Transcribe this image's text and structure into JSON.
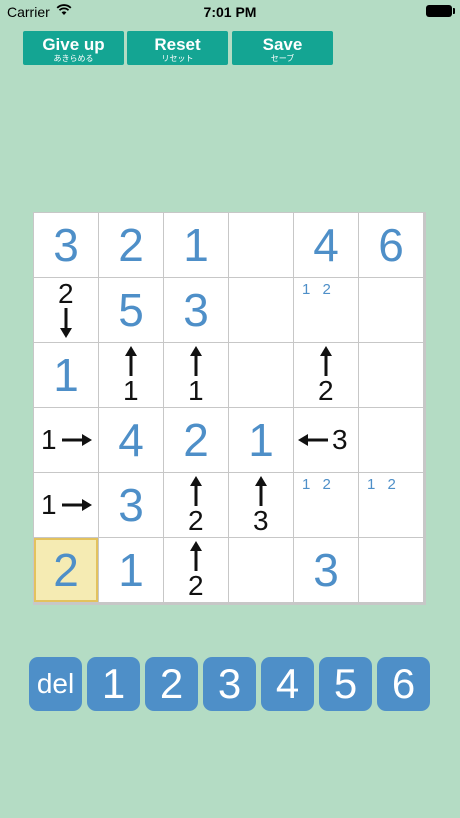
{
  "status_bar": {
    "carrier": "Carrier",
    "time": "7:01 PM"
  },
  "toolbar": {
    "give_up": {
      "label": "Give up",
      "sub": "あきらめる"
    },
    "reset": {
      "label": "Reset",
      "sub": "リセット"
    },
    "save": {
      "label": "Save",
      "sub": "セーブ"
    }
  },
  "board": {
    "size": 6,
    "selected": "r5c0",
    "cells": {
      "r0c0": {
        "value": "3"
      },
      "r0c1": {
        "value": "2"
      },
      "r0c2": {
        "value": "1"
      },
      "r0c4": {
        "value": "4"
      },
      "r0c5": {
        "value": "6"
      },
      "r1c0": {
        "clue": "2",
        "arrow": "down"
      },
      "r1c1": {
        "value": "5"
      },
      "r1c2": {
        "value": "3"
      },
      "r1c4": {
        "candidates": "1 2"
      },
      "r2c0": {
        "value": "1"
      },
      "r2c1": {
        "clue": "1",
        "arrow": "up"
      },
      "r2c2": {
        "clue": "1",
        "arrow": "up"
      },
      "r2c4": {
        "clue": "2",
        "arrow": "up"
      },
      "r3c0": {
        "clue": "1",
        "arrow": "right"
      },
      "r3c1": {
        "value": "4"
      },
      "r3c2": {
        "value": "2"
      },
      "r3c3": {
        "value": "1"
      },
      "r3c4": {
        "clue": "3",
        "arrow": "left"
      },
      "r4c0": {
        "clue": "1",
        "arrow": "right"
      },
      "r4c1": {
        "value": "3"
      },
      "r4c2": {
        "clue": "2",
        "arrow": "up"
      },
      "r4c3": {
        "clue": "3",
        "arrow": "up"
      },
      "r4c4": {
        "candidates": "1 2"
      },
      "r4c5": {
        "candidates": "1 2"
      },
      "r5c0": {
        "value": "2"
      },
      "r5c1": {
        "value": "1"
      },
      "r5c2": {
        "clue": "2",
        "arrow": "up"
      },
      "r5c4": {
        "value": "3"
      }
    }
  },
  "keypad": [
    "del",
    "1",
    "2",
    "3",
    "4",
    "5",
    "6"
  ],
  "colors": {
    "background": "#b4dcc4",
    "button": "#14a593",
    "digit": "#4e8fc8",
    "selected": "#f5ebb3"
  }
}
